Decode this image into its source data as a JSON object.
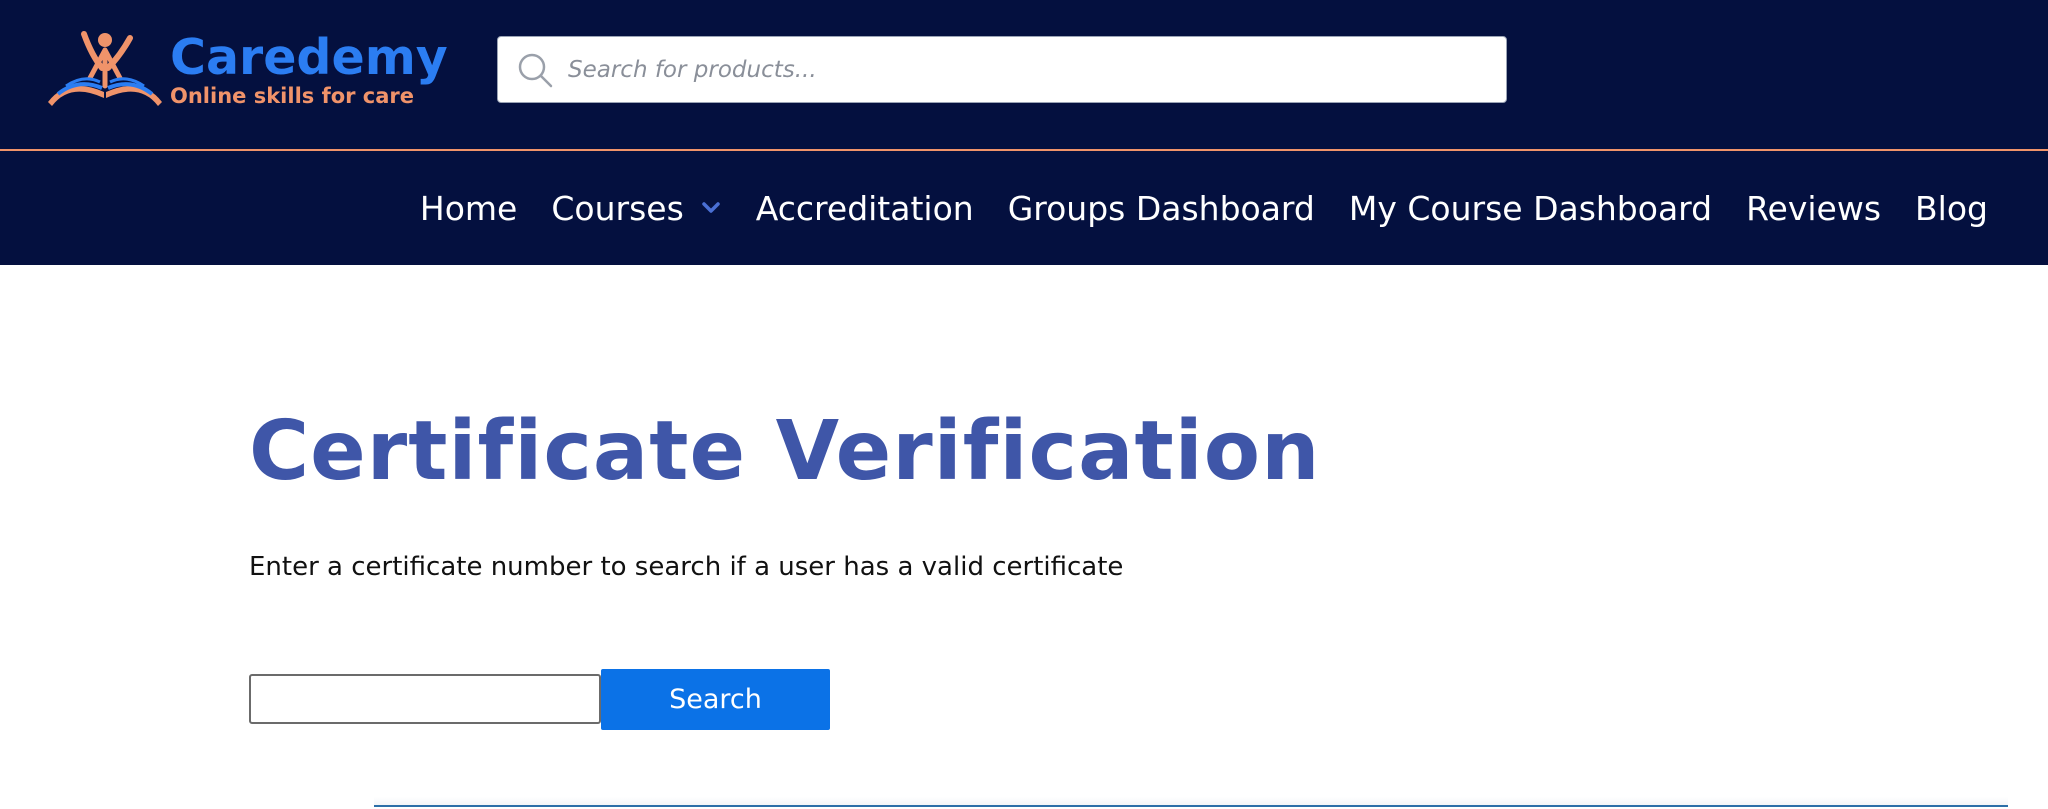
{
  "brand": {
    "name": "Caredemy",
    "tagline": "Online skills for care",
    "primary_color": "#2b7df2",
    "accent_color": "#f0936a"
  },
  "header": {
    "background_color": "#04103f",
    "search": {
      "placeholder": "Search for products...",
      "value": "",
      "icon": "search-icon"
    }
  },
  "nav": {
    "items": [
      {
        "label": "Home"
      },
      {
        "label": "Courses",
        "icon": "chevron-down-icon"
      },
      {
        "label": "Accreditation"
      },
      {
        "label": "Groups Dashboard"
      },
      {
        "label": "My Course Dashboard"
      },
      {
        "label": "Reviews"
      },
      {
        "label": "Blog"
      }
    ]
  },
  "main": {
    "title": "Certificate Verification",
    "title_color": "#3f56a8",
    "description": "Enter a certificate number to search if a user has a valid certificate",
    "certificate_input": {
      "value": "",
      "placeholder": ""
    },
    "search_button": {
      "label": "Search",
      "color": "#0b72e7"
    }
  }
}
